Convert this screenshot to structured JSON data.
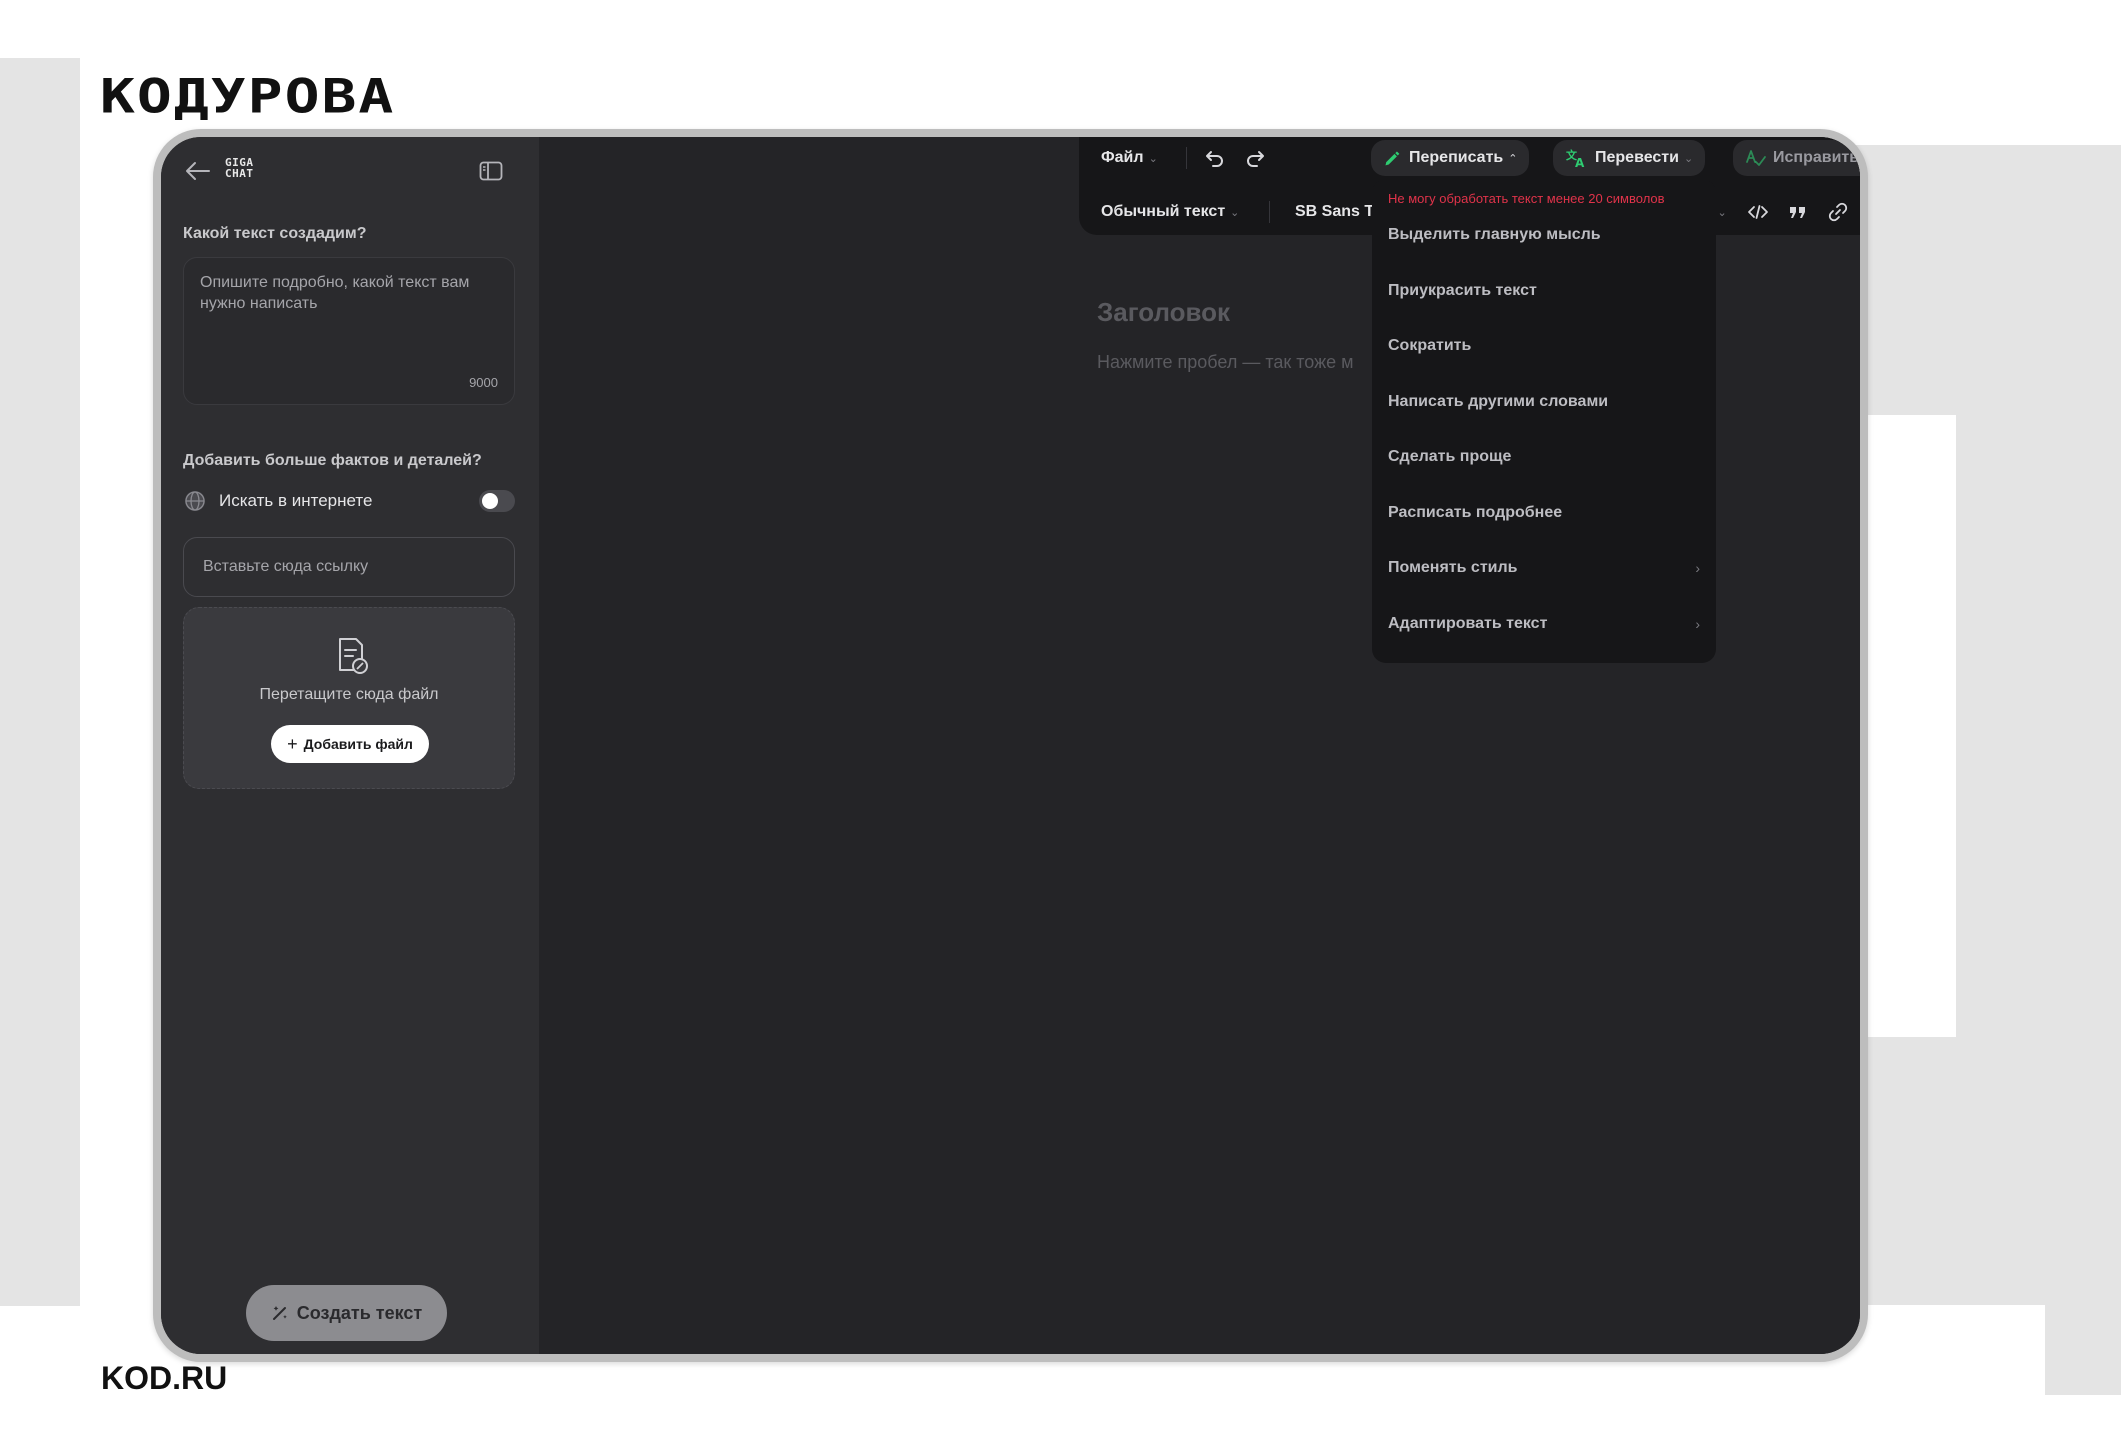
{
  "brand": {
    "logo_text": "КОДУРОВА",
    "footer_text": "KOD.RU"
  },
  "sidebar": {
    "logo_text": "GIGA CHAT",
    "prompt_label": "Какой текст создадим?",
    "prompt_placeholder": "Опишите подробно, какой текст вам нужно написать",
    "prompt_counter": "9000",
    "facts_label": "Добавить больше фактов и деталей?",
    "search_label": "Искать в интернете",
    "search_enabled": false,
    "link_placeholder": "Вставьте сюда ссылку",
    "dropzone_text": "Перетащите сюда файл",
    "add_file_label": "Добавить файл",
    "create_label": "Создать текст"
  },
  "toolbar": {
    "file_label": "Файл",
    "rewrite_label": "Переписать",
    "translate_label": "Перевести",
    "fix_label": "Исправить ошибки",
    "style_label": "Обычный текст",
    "font_label": "SB Sans T"
  },
  "editor": {
    "heading_placeholder": "Заголовок",
    "body_placeholder": "Нажмите пробел — так тоже м"
  },
  "rewrite_menu": {
    "error": "Не могу обработать текст менее 20 символов",
    "items": [
      {
        "label": "Выделить главную мысль",
        "has_submenu": false
      },
      {
        "label": "Приукрасить текст",
        "has_submenu": false
      },
      {
        "label": "Сократить",
        "has_submenu": false
      },
      {
        "label": "Написать другими словами",
        "has_submenu": false
      },
      {
        "label": "Сделать проще",
        "has_submenu": false
      },
      {
        "label": "Расписать подробнее",
        "has_submenu": false
      },
      {
        "label": "Поменять стиль",
        "has_submenu": true
      },
      {
        "label": "Адаптировать текст",
        "has_submenu": true
      }
    ]
  },
  "colors": {
    "accent": "#2ecc71",
    "error": "#e0334a",
    "panel": "#2e2e31",
    "editor": "#242427"
  }
}
